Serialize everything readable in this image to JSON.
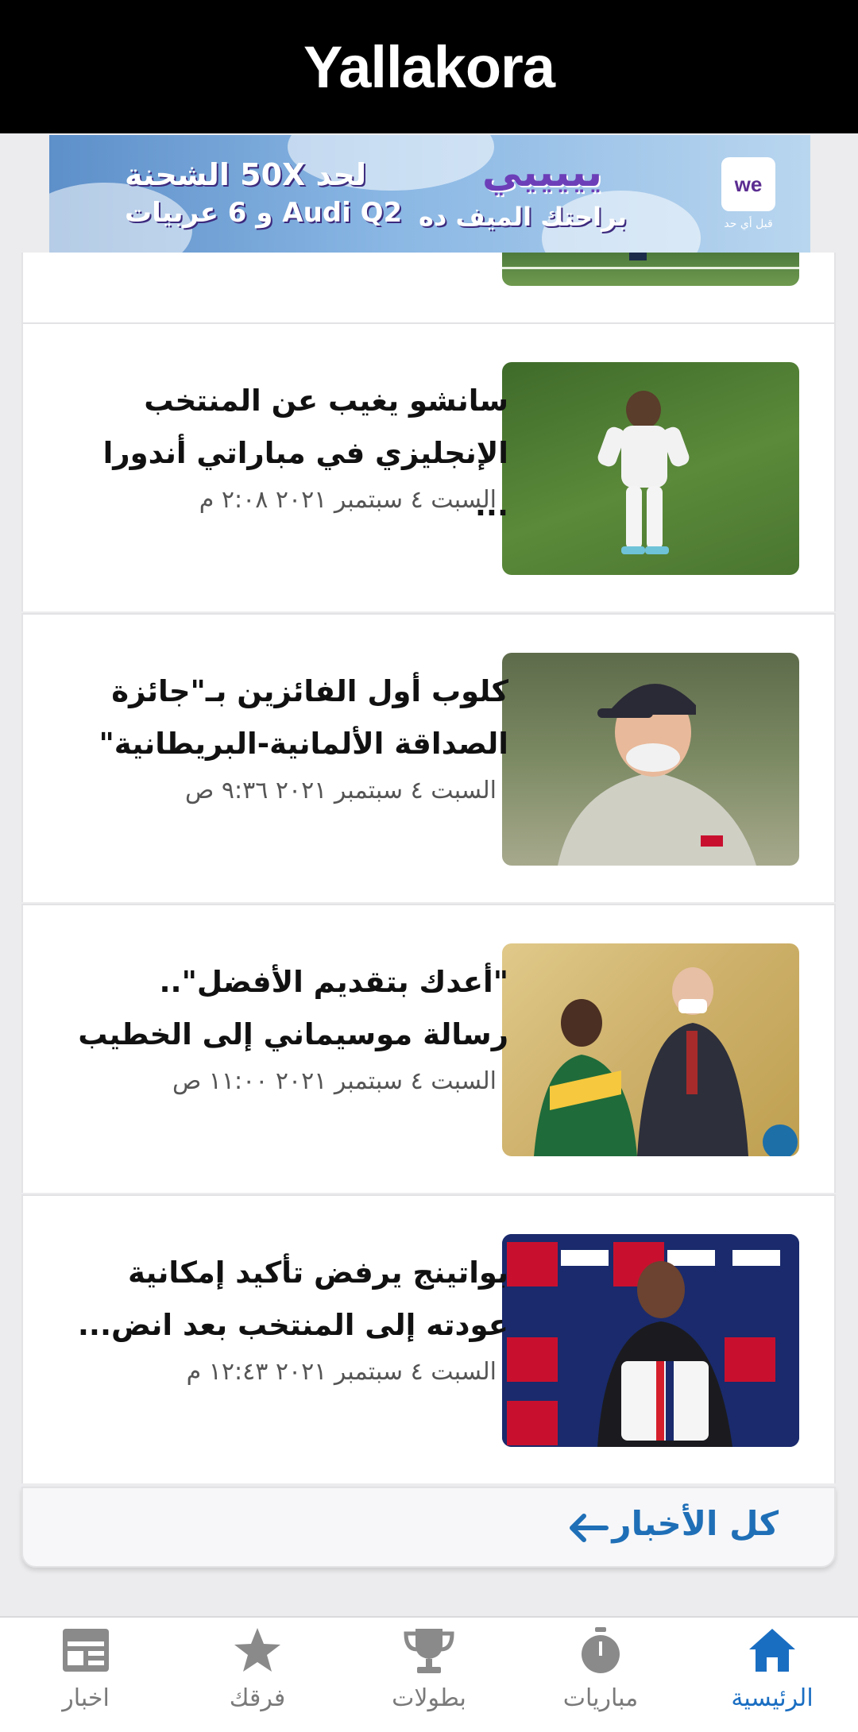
{
  "app": {
    "logo": "Yallakora"
  },
  "ad": {
    "line_top_right": "لحد 50X الشحنة",
    "line_bottom_right": "Audi Q2 و 6 عربيات",
    "headline": "يييييي",
    "subline": "براحتك الميف ده",
    "brand": "we",
    "brand_tag": "قبل أي حد",
    "colors": {
      "brand_purple": "#5c2d91",
      "sky": "#8ab7e4"
    }
  },
  "articles": [
    {
      "title": "سانشو يغيب عن المنتخب الإنجليزي في مباراتي أندورا ...",
      "date": "السبت ٤ سبتمبر ٢٠٢١ ٢:٠٨ م",
      "image": "football-player-pitch"
    },
    {
      "title": "كلوب أول الفائزين بـ\"جائزة الصداقة الألمانية-البريطانية\"",
      "date": "السبت ٤ سبتمبر ٢٠٢١ ٩:٣٦ ص",
      "image": "coach-smiling"
    },
    {
      "title": "\"أعدك بتقديم الأفضل\".. رسالة موسيماني إلى الخطيب",
      "date": "السبت ٤ سبتمبر ٢٠٢١ ١١:٠٠ ص",
      "image": "handshake-ceremony"
    },
    {
      "title": "بواتينج يرفض تأكيد إمكانية عودته إلى المنتخب بعد انض...",
      "date": "السبت ٤ سبتمبر ٢٠٢١ ١٢:٤٣ م",
      "image": "player-presentation-jersey"
    }
  ],
  "all_news": {
    "label": "كل الأخبار"
  },
  "nav": {
    "items": [
      {
        "label": "اخبار",
        "icon": "newspaper-icon"
      },
      {
        "label": "فرقك",
        "icon": "star-icon"
      },
      {
        "label": "بطولات",
        "icon": "trophy-icon"
      },
      {
        "label": "مباريات",
        "icon": "stopwatch-icon"
      },
      {
        "label": "الرئيسية",
        "icon": "home-icon"
      }
    ],
    "active_color": "#1a6ec2",
    "inactive_color": "#7a7a7a"
  }
}
